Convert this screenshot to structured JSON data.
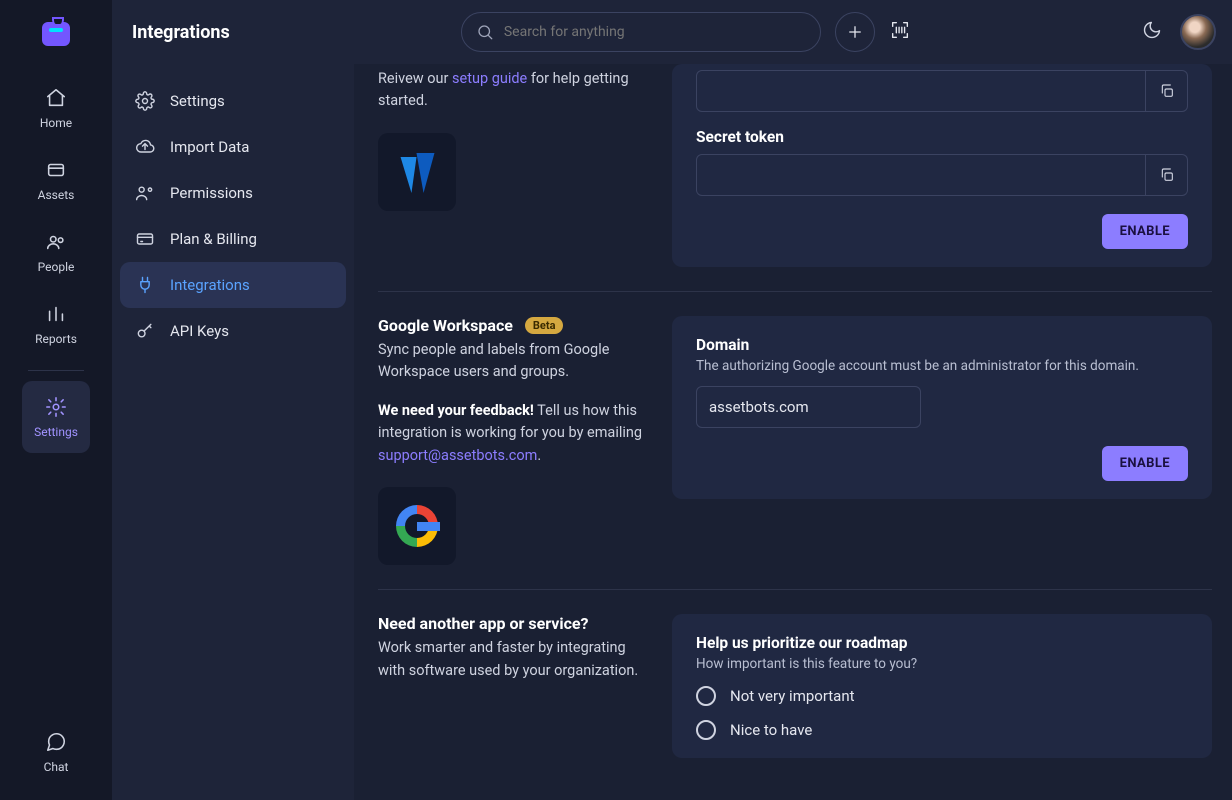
{
  "page_title": "Integrations",
  "search": {
    "placeholder": "Search for anything"
  },
  "rail": {
    "home": "Home",
    "assets": "Assets",
    "people": "People",
    "reports": "Reports",
    "settings": "Settings",
    "chat": "Chat"
  },
  "sidepanel": {
    "settings": "Settings",
    "import_data": "Import Data",
    "permissions": "Permissions",
    "plan_billing": "Plan & Billing",
    "integrations": "Integrations",
    "api_keys": "API Keys"
  },
  "azure": {
    "review_prefix": "Reivew our ",
    "setup_link": "setup guide",
    "review_suffix": " for help getting started.",
    "secret_label": "Secret token",
    "secret_value": "",
    "enable": "ENABLE"
  },
  "google": {
    "title": "Google Workspace",
    "badge": "Beta",
    "desc": "Sync people and labels from Google Workspace users and groups.",
    "feedback_strong": "We need your feedback!",
    "feedback_rest": " Tell us how this integration is working for you by emailing ",
    "support_email": "support@assetbots.com",
    "domain_label": "Domain",
    "domain_help": "The authorizing Google account must be an administrator for this domain.",
    "domain_value": "assetbots.com",
    "enable": "ENABLE"
  },
  "another": {
    "title": "Need another app or service?",
    "desc": "Work smarter and faster by integrating with software used by your organization.",
    "card_title": "Help us prioritize our roadmap",
    "card_help": "How important is this feature to you?",
    "opt1": "Not very important",
    "opt2": "Nice to have"
  }
}
